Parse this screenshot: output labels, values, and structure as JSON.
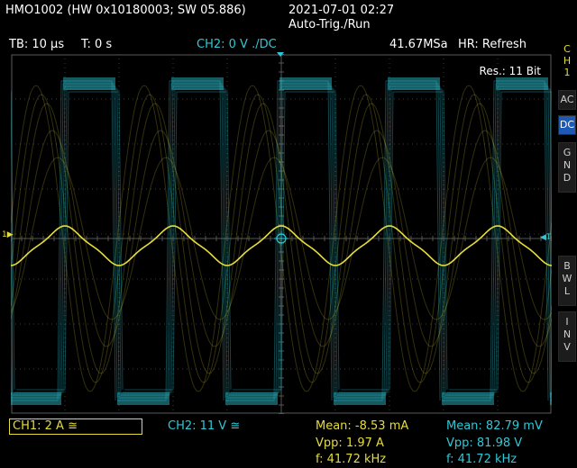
{
  "device": {
    "id": "HMO1002 (HW 0x10180003; SW 05.886)",
    "datetime": "2021-07-01 02:27",
    "trigger_mode": "Auto-Trig./Run"
  },
  "info": {
    "timebase": "TB: 10 µs",
    "trigger_time": "T: 0 s",
    "ch2_setting": "CH2: 0 V ./DC",
    "sample_rate": "41.67MSa",
    "hr_mode": "HR: Refresh",
    "resolution": "Res.: 11 Bit"
  },
  "side": {
    "channel_label": "CH1",
    "buttons": [
      "AC",
      "DC",
      "GND",
      "BWL",
      "INV"
    ],
    "active": "DC"
  },
  "status": {
    "ch1": "CH1: 2 A ≅",
    "ch2": "CH2: 11 V ≅",
    "ch1_mean": "Mean: -8.53 mA",
    "ch1_vpp": "Vpp: 1.97 A",
    "ch1_freq": "f: 41.72 kHz",
    "ch2_mean": "Mean: 82.79 mV",
    "ch2_vpp": "Vpp: 81.98 V",
    "ch2_freq": "f: 41.72 kHz"
  },
  "markers": {
    "ch1_marker": "1",
    "trigger_marker": "T"
  },
  "colors": {
    "ch1": "#e6dc3c",
    "ch2": "#2fc8d6",
    "grid": "#3a3a3a",
    "active_button": "#1e5ab4"
  }
}
